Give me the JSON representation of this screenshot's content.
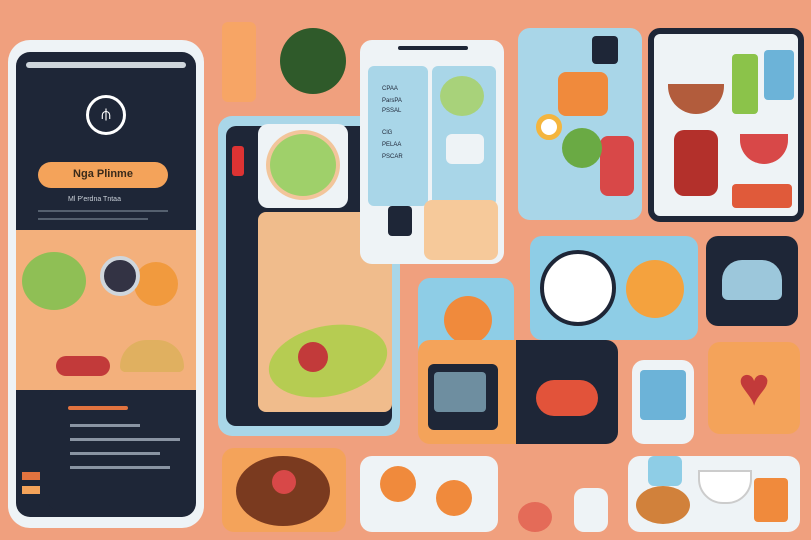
{
  "app": {
    "button_label": "Nga Plinme",
    "subtitle": "Ml P'erdna Tntaa",
    "fridge_labels": [
      "CPAA",
      "ParsPA",
      "PSSAL",
      "ClG",
      "PELAA",
      "PSCAR"
    ],
    "logo_icon": "fork-knife-icon",
    "accent": "#f4a35a",
    "panel": "#1e2637"
  }
}
